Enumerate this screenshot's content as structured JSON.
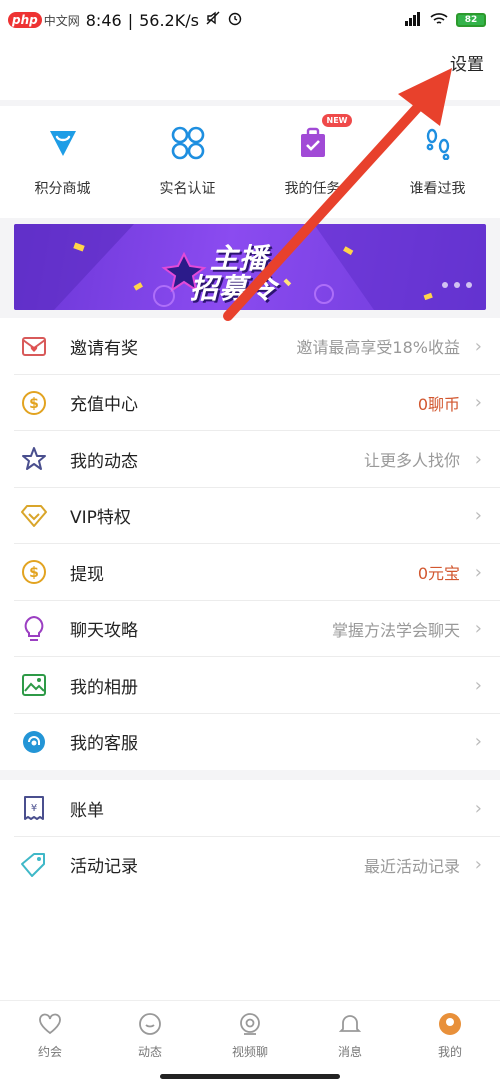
{
  "status_bar": {
    "time": "8:46",
    "speed": "56.2K/s",
    "watermark_php": "php",
    "watermark_cn": "中文网",
    "battery": "82"
  },
  "header": {
    "settings_label": "设置"
  },
  "grid": [
    {
      "label": "积分商城",
      "icon": "diamond-icon"
    },
    {
      "label": "实名认证",
      "icon": "clover-icon"
    },
    {
      "label": "我的任务",
      "icon": "task-bag-icon",
      "badge": "NEW"
    },
    {
      "label": "谁看过我",
      "icon": "footprint-icon"
    }
  ],
  "banner": {
    "line1": "主播",
    "line2": "招募令"
  },
  "list": [
    {
      "label": "邀请有奖",
      "value": "邀请最高享受18%收益",
      "icon": "invite-envelope-icon",
      "value_color": "gray"
    },
    {
      "label": "充值中心",
      "value": "0聊币",
      "icon": "coin-dollar-icon",
      "value_color": "red"
    },
    {
      "label": "我的动态",
      "value": "让更多人找你",
      "icon": "star-icon",
      "value_color": "gray"
    },
    {
      "label": "VIP特权",
      "value": "",
      "icon": "vip-diamond-icon",
      "value_color": "gray"
    },
    {
      "label": "提现",
      "value": "0元宝",
      "icon": "withdraw-coin-icon",
      "value_color": "red"
    },
    {
      "label": "聊天攻略",
      "value": "掌握方法学会聊天",
      "icon": "bulb-icon",
      "value_color": "gray"
    },
    {
      "label": "我的相册",
      "value": "",
      "icon": "photo-album-icon",
      "value_color": "gray"
    },
    {
      "label": "我的客服",
      "value": "",
      "icon": "customer-service-icon",
      "value_color": "gray"
    },
    {
      "label": "账单",
      "value": "",
      "icon": "bill-icon",
      "value_color": "gray"
    },
    {
      "label": "活动记录",
      "value": "最近活动记录",
      "icon": "tag-icon",
      "value_color": "gray"
    }
  ],
  "bottom_nav": [
    {
      "label": "约会",
      "icon": "heart-icon"
    },
    {
      "label": "动态",
      "icon": "chat-bubble-icon"
    },
    {
      "label": "视频聊",
      "icon": "video-icon"
    },
    {
      "label": "消息",
      "icon": "bell-icon"
    },
    {
      "label": "我的",
      "icon": "profile-icon"
    }
  ],
  "colors": {
    "accent_red": "#e8412c",
    "value_red": "#d2572f",
    "banner_purple": "#7a44e6"
  }
}
